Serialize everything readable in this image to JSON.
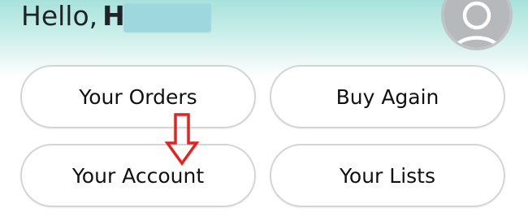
{
  "header": {
    "greeting": "Hello,",
    "name_visible": "H"
  },
  "avatar": {
    "icon": "user-avatar-icon"
  },
  "buttons": {
    "orders": "Your Orders",
    "buy_again": "Buy Again",
    "account": "Your Account",
    "lists": "Your Lists"
  },
  "annotation": {
    "icon": "down-arrow-icon",
    "color": "#e52222"
  },
  "colors": {
    "header_gradient_top": "#a8e2dc",
    "button_border": "#d2d5d7",
    "text": "#111111"
  }
}
